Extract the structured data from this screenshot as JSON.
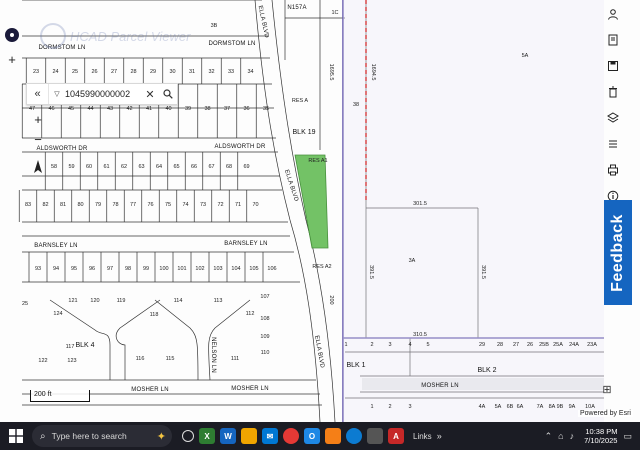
{
  "watermark": {
    "text": "HCAD Parcel Viewer"
  },
  "search": {
    "value": "1045990000002"
  },
  "map": {
    "streets": {
      "dormstom_west": "DORMSTOM LN",
      "dormstom_east": "DORMSTOM LN",
      "aldsworth_west": "ALDSWORTH DR",
      "aldsworth_east": "ALDSWORTH DR",
      "barnsley_west": "BARNSLEY LN",
      "barnsley_east": "BARNSLEY LN",
      "mosher_west": "MOSHER LN",
      "mosher_mid": "MOSHER LN",
      "mosher_east": "MOSHER LN",
      "ella_top": "ELLA BLVD",
      "ella_mid": "ELLA BLVD",
      "ella_bottom": "ELLA BLVD",
      "nelson": "NELSON LN",
      "road_n157a": "N157A"
    },
    "blocks": {
      "blk19": "BLK 19",
      "blk4": "BLK 4",
      "blk1": "BLK 1",
      "blk2": "BLK 2"
    },
    "reserves": {
      "res_a": "RES A",
      "res_a1": "RES A1",
      "res_a2": "RES A2"
    },
    "tracts": {
      "t5a": "5A",
      "t3a": "3A",
      "t38": "38",
      "t3b": "3B",
      "t1c": "1C"
    },
    "dims": {
      "d301": "301.5",
      "d310": "310.5",
      "d391a": "391.5",
      "d391b": "391.5",
      "d1695": "1695.5",
      "d1694": "1694.5",
      "d200": "200"
    },
    "lots": {
      "row1": [
        "23",
        "24",
        "25",
        "26",
        "27",
        "28",
        "29",
        "30",
        "31",
        "32",
        "33",
        "34"
      ],
      "row2": [
        "47",
        "46",
        "45",
        "44",
        "43",
        "42",
        "41",
        "40",
        "39",
        "38",
        "37",
        "36",
        "35"
      ],
      "row3": [
        "58",
        "59",
        "60",
        "61",
        "62",
        "63",
        "64",
        "65",
        "66",
        "67",
        "68",
        "69"
      ],
      "row4": [
        "83",
        "82",
        "81",
        "80",
        "79",
        "78",
        "77",
        "76",
        "75",
        "74",
        "73",
        "72",
        "71",
        "70"
      ],
      "row5": [
        "93",
        "94",
        "95",
        "96",
        "97",
        "98",
        "99",
        "100",
        "101",
        "102",
        "103",
        "104",
        "105",
        "106"
      ],
      "row6": [
        "25",
        "121",
        "120",
        "119",
        "118",
        "114",
        "113",
        "112",
        "107",
        "108",
        "109",
        "110",
        "111",
        "115",
        "116",
        "117",
        "122",
        "123",
        "124"
      ],
      "east1": [
        "1",
        "2",
        "3",
        "4",
        "5",
        "29",
        "28",
        "27",
        "26",
        "25B",
        "25A",
        "24A",
        "23A",
        "22A"
      ],
      "east2": [
        "1",
        "2",
        "3",
        "4A",
        "5A",
        "6B",
        "6A",
        "7A",
        "8A",
        "9B",
        "9A",
        "10A"
      ]
    }
  },
  "tools": [
    "user-icon",
    "bookmark-icon",
    "save-icon",
    "delete-icon",
    "layers-icon",
    "list-icon",
    "print-icon",
    "info-icon"
  ],
  "feedback": {
    "label": "Feedback"
  },
  "scale": {
    "label": "200 ft"
  },
  "attribution": {
    "text": "Powered by Esri"
  },
  "taskbar": {
    "search_placeholder": "Type here to search",
    "links_label": "Links",
    "time": "10:38 PM",
    "date": "7/10/2025"
  },
  "colors": {
    "accent": "#1565c0",
    "parcel_highlight": "#6cbf5e",
    "boundary": "#6b5fb0",
    "redline": "#d32f2f"
  }
}
